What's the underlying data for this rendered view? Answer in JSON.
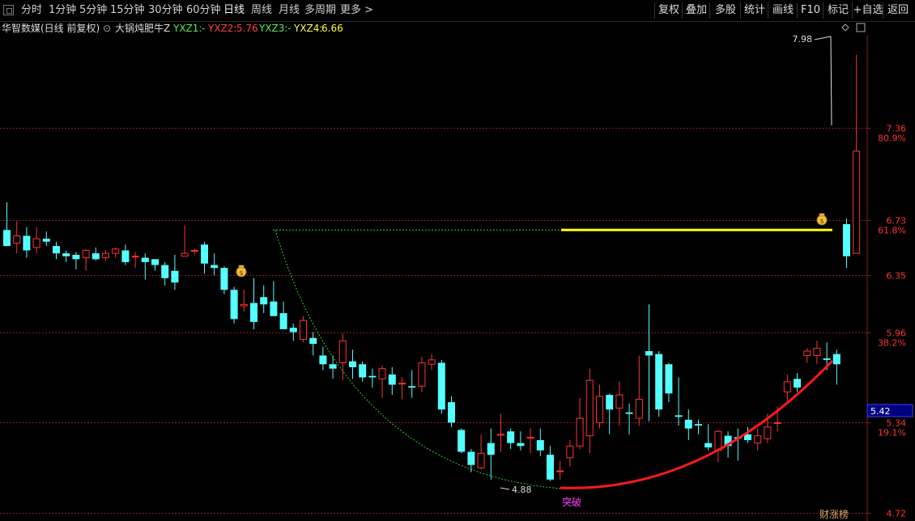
{
  "toolbar": {
    "periods": [
      "分时",
      "1分钟",
      "5分钟",
      "15分钟",
      "30分钟",
      "60分钟",
      "日线",
      "周线",
      "月线",
      "多周期",
      "更多 >"
    ],
    "active": "日线",
    "actions": [
      "复权",
      "叠加",
      "多股",
      "统计",
      "画线",
      "F10",
      "标记",
      "+自选",
      "返回"
    ]
  },
  "info": {
    "stock": "华智数媒(日线 前复权)",
    "indicator": "大锅炖肥牛Z",
    "yxz1_label": "YXZ1:",
    "yxz1_value": "-",
    "yxz2_label": "YXZ2:",
    "yxz2_value": "5.76",
    "yxz3_label": "YXZ3:",
    "yxz3_value": "-",
    "yxz4_label": "YXZ4:",
    "yxz4_value": "6.66"
  },
  "colors": {
    "up": "#ff3232",
    "down": "#54ffff",
    "grid": "#8a1e1e",
    "yellow": "#ffff00",
    "green_dash": "#33cc33",
    "arc": "#ff1a1a",
    "current_box": "#000080"
  },
  "chart_data": {
    "type": "candlestick",
    "y_ticks": [
      {
        "value": 7.36,
        "label": "7.36",
        "pct": "80.9%"
      },
      {
        "value": 6.73,
        "label": "6.73",
        "pct": "61.8%"
      },
      {
        "value": 6.35,
        "label": "6.35",
        "pct": ""
      },
      {
        "value": 5.96,
        "label": "5.96",
        "pct": "38.2%"
      },
      {
        "value": 5.34,
        "label": "5.34",
        "pct": "19.1%"
      },
      {
        "value": 4.72,
        "label": "4.72",
        "pct": ""
      }
    ],
    "current_price": "5.42",
    "high_annotation": "7.98",
    "low_annotation": "4.88",
    "signal_text": "突破",
    "logo_text": "财涨榜",
    "yellow_level": 6.66,
    "candles": [
      [
        6.66,
        6.55,
        6.85,
        6.55
      ],
      [
        6.57,
        6.62,
        6.72,
        6.5
      ],
      [
        6.62,
        6.52,
        6.68,
        6.47
      ],
      [
        6.54,
        6.6,
        6.68,
        6.5
      ],
      [
        6.6,
        6.58,
        6.65,
        6.55
      ],
      [
        6.55,
        6.5,
        6.58,
        6.46
      ],
      [
        6.5,
        6.48,
        6.52,
        6.44
      ],
      [
        6.49,
        6.46,
        6.51,
        6.39
      ],
      [
        6.47,
        6.52,
        6.53,
        6.38
      ],
      [
        6.5,
        6.46,
        6.54,
        6.45
      ],
      [
        6.47,
        6.5,
        6.52,
        6.45
      ],
      [
        6.5,
        6.53,
        6.54,
        6.47
      ],
      [
        6.52,
        6.44,
        6.56,
        6.42
      ],
      [
        6.48,
        6.48,
        6.51,
        6.4
      ],
      [
        6.47,
        6.44,
        6.5,
        6.32
      ],
      [
        6.46,
        6.42,
        6.45,
        6.38
      ],
      [
        6.42,
        6.33,
        6.44,
        6.28
      ],
      [
        6.38,
        6.3,
        6.49,
        6.25
      ],
      [
        6.48,
        6.5,
        6.69,
        6.48
      ],
      [
        6.52,
        6.52,
        6.53,
        6.49
      ],
      [
        6.56,
        6.43,
        6.58,
        6.36
      ],
      [
        6.42,
        6.4,
        6.5,
        6.35
      ],
      [
        6.4,
        6.25,
        6.41,
        6.22
      ],
      [
        6.25,
        6.05,
        6.27,
        6.02
      ],
      [
        6.14,
        6.15,
        6.25,
        6.1
      ],
      [
        6.16,
        6.03,
        6.33,
        5.98
      ],
      [
        6.2,
        6.15,
        6.28,
        6.09
      ],
      [
        6.17,
        6.07,
        6.31,
        6.07
      ],
      [
        6.09,
        5.98,
        6.17,
        5.98
      ],
      [
        5.99,
        5.96,
        6.02,
        5.9
      ],
      [
        5.91,
        6.04,
        6.07,
        5.89
      ],
      [
        5.92,
        5.88,
        5.96,
        5.8
      ],
      [
        5.8,
        5.74,
        5.86,
        5.7
      ],
      [
        5.74,
        5.71,
        5.8,
        5.64
      ],
      [
        5.75,
        5.9,
        5.95,
        5.63
      ],
      [
        5.76,
        5.72,
        5.84,
        5.64
      ],
      [
        5.74,
        5.65,
        5.76,
        5.62
      ],
      [
        5.66,
        5.65,
        5.71,
        5.58
      ],
      [
        5.64,
        5.71,
        5.73,
        5.51
      ],
      [
        5.67,
        5.6,
        5.72,
        5.53
      ],
      [
        5.61,
        5.61,
        5.65,
        5.5
      ],
      [
        5.59,
        5.58,
        5.7,
        5.51
      ],
      [
        5.59,
        5.75,
        5.79,
        5.55
      ],
      [
        5.74,
        5.77,
        5.81,
        5.7
      ],
      [
        5.75,
        5.43,
        5.77,
        5.4
      ],
      [
        5.48,
        5.34,
        5.52,
        5.31
      ],
      [
        5.29,
        5.14,
        5.3,
        5.13
      ],
      [
        5.14,
        5.05,
        5.16,
        5.0
      ],
      [
        5.03,
        5.13,
        5.26,
        5.02
      ],
      [
        5.2,
        5.12,
        5.3,
        4.95
      ],
      [
        5.26,
        5.26,
        5.4,
        5.14
      ],
      [
        5.28,
        5.2,
        5.3,
        5.16
      ],
      [
        5.2,
        5.18,
        5.28,
        5.15
      ],
      [
        5.24,
        5.24,
        5.3,
        5.13
      ],
      [
        5.22,
        5.15,
        5.3,
        5.11
      ],
      [
        5.12,
        4.95,
        5.18,
        4.94
      ],
      [
        5.01,
        5.01,
        5.08,
        4.95
      ],
      [
        5.1,
        5.18,
        5.22,
        5.04
      ],
      [
        5.18,
        5.37,
        5.51,
        5.16
      ],
      [
        5.25,
        5.63,
        5.71,
        5.13
      ],
      [
        5.34,
        5.52,
        5.6,
        5.3
      ],
      [
        5.53,
        5.43,
        5.54,
        5.26
      ],
      [
        5.44,
        5.53,
        5.62,
        5.32
      ],
      [
        5.41,
        5.4,
        5.47,
        5.26
      ],
      [
        5.37,
        5.5,
        5.8,
        5.32
      ],
      [
        5.83,
        5.8,
        6.15,
        5.35
      ],
      [
        5.81,
        5.43,
        5.83,
        5.38
      ],
      [
        5.74,
        5.54,
        5.75,
        5.48
      ],
      [
        5.39,
        5.38,
        5.65,
        5.32
      ],
      [
        5.36,
        5.3,
        5.43,
        5.22
      ],
      [
        5.33,
        5.32,
        5.36,
        5.26
      ],
      [
        5.2,
        5.17,
        5.33,
        5.15
      ],
      [
        5.15,
        5.28,
        5.29,
        5.07
      ],
      [
        5.25,
        5.18,
        5.28,
        5.1
      ],
      [
        5.24,
        5.23,
        5.3,
        5.08
      ],
      [
        5.26,
        5.22,
        5.31,
        5.2
      ],
      [
        5.2,
        5.25,
        5.3,
        5.15
      ],
      [
        5.23,
        5.31,
        5.4,
        5.2
      ],
      [
        5.34,
        5.34,
        5.45,
        5.28
      ],
      [
        5.55,
        5.62,
        5.67,
        5.47
      ],
      [
        5.64,
        5.58,
        5.68,
        5.55
      ],
      [
        5.8,
        5.83,
        5.85,
        5.75
      ],
      [
        5.8,
        5.85,
        5.9,
        5.74
      ],
      [
        5.78,
        5.77,
        5.89,
        5.7
      ],
      [
        5.81,
        5.74,
        5.84,
        5.6
      ],
      [
        6.7,
        6.48,
        6.74,
        6.4
      ],
      [
        6.5,
        7.2,
        7.86,
        6.52
      ]
    ]
  }
}
